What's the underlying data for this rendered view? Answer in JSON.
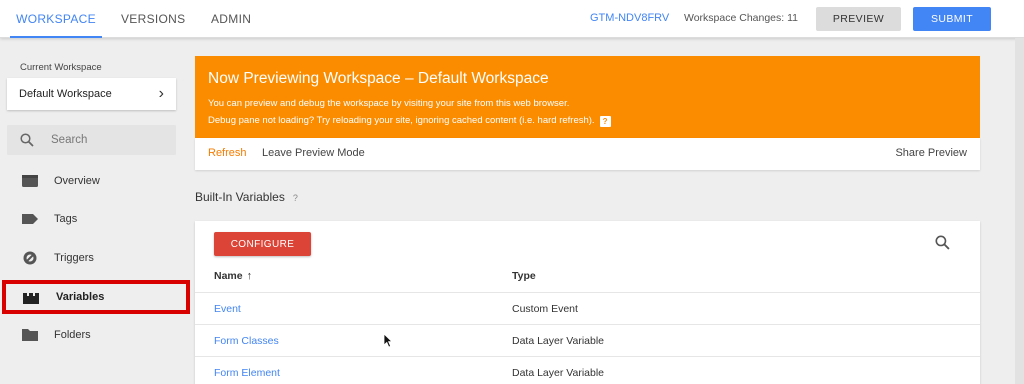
{
  "topbar": {
    "tabs": [
      {
        "label": "WORKSPACE",
        "active": true
      },
      {
        "label": "VERSIONS",
        "active": false
      },
      {
        "label": "ADMIN",
        "active": false
      }
    ],
    "container_id": "GTM-NDV8FRV",
    "workspace_changes": "Workspace Changes: 11",
    "preview_label": "PREVIEW",
    "submit_label": "SUBMIT"
  },
  "sidebar": {
    "current_workspace_label": "Current Workspace",
    "current_workspace_value": "Default Workspace",
    "search_placeholder": "Search",
    "items": [
      {
        "label": "Overview",
        "icon": "overview-icon"
      },
      {
        "label": "Tags",
        "icon": "tag-icon"
      },
      {
        "label": "Triggers",
        "icon": "trigger-icon"
      },
      {
        "label": "Variables",
        "icon": "variables-icon",
        "active": true
      },
      {
        "label": "Folders",
        "icon": "folder-icon"
      }
    ]
  },
  "preview_banner": {
    "title": "Now Previewing Workspace – Default Workspace",
    "line1": "You can preview and debug the workspace by visiting your site from this web browser.",
    "line2": "Debug pane not loading? Try reloading your site, ignoring cached content (i.e. hard refresh).",
    "help_mark": "?",
    "refresh_label": "Refresh",
    "leave_label": "Leave Preview Mode",
    "share_label": "Share Preview"
  },
  "builtin_variables": {
    "title": "Built-In Variables",
    "help_mark": "?",
    "configure_label": "CONFIGURE",
    "columns": {
      "name": "Name",
      "type": "Type"
    },
    "sort_indicator": "↑",
    "rows": [
      {
        "name": "Event",
        "type": "Custom Event"
      },
      {
        "name": "Form Classes",
        "type": "Data Layer Variable"
      },
      {
        "name": "Form Element",
        "type": "Data Layer Variable"
      }
    ]
  },
  "colors": {
    "accent": "#4285f4",
    "banner": "#fb8c00",
    "configure": "#db4437",
    "highlight": "#d90000"
  }
}
